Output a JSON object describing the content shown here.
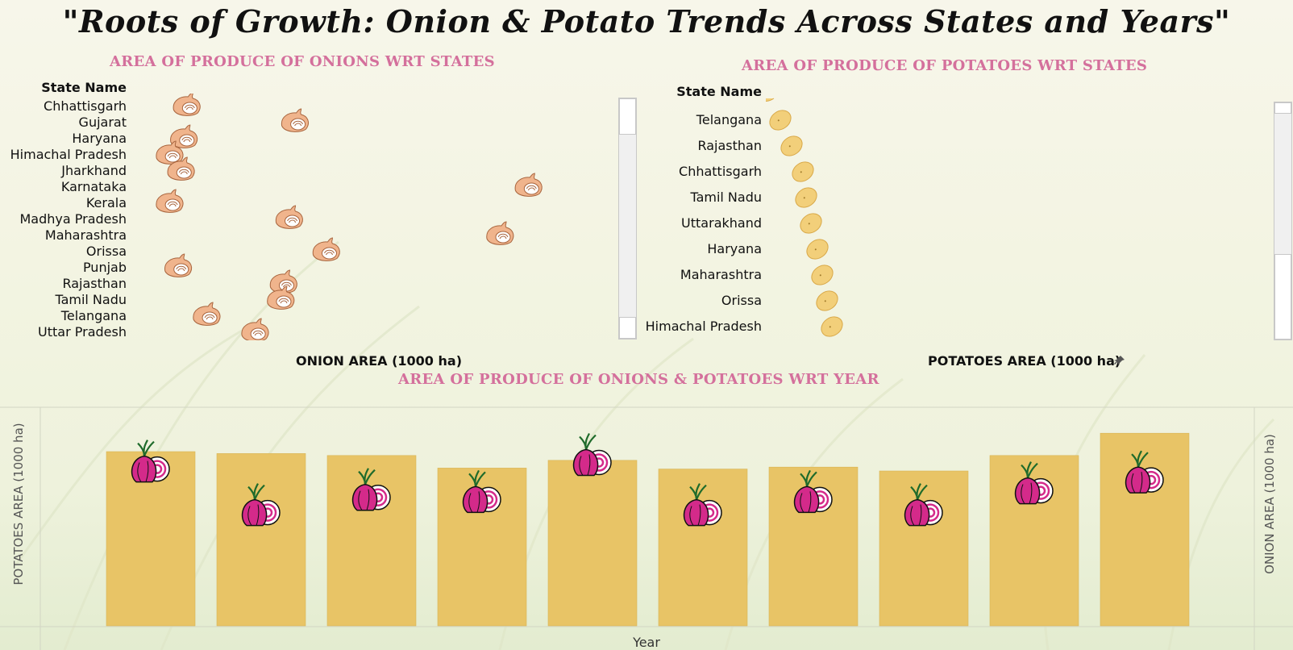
{
  "title": "\"Roots of Growth: Onion & Potato Trends Across States and Years\"",
  "onion_panel": {
    "title": "AREA OF PRODUCE OF ONIONS WRT STATES",
    "row_header": "State Name",
    "axis_title": "ONION AREA (1000 ha)"
  },
  "potato_panel": {
    "title": "AREA OF PRODUCE OF POTATOES WRT STATES",
    "row_header": "State Name",
    "axis_title": "POTATOES AREA (1000 ha)"
  },
  "year_panel": {
    "title": "AREA OF PRODUCE OF ONIONS & POTATOES WRT YEAR",
    "xlabel": "Year",
    "ylabel_left": "POTATOES AREA (1000 ha)",
    "ylabel_right": "ONION AREA (1000 ha)"
  },
  "colors": {
    "title_pink": "#d4709c",
    "bar_fill": "#e8c466",
    "onion_skin": "#f0b48c",
    "potato": "#f2cf7a",
    "red_onion": "#d42a8a"
  },
  "icons": [
    "onion-icon",
    "potato-icon",
    "red-onion-icon",
    "pin-icon"
  ],
  "chart_data": [
    {
      "type": "scatter",
      "mark": "onion-icon",
      "categories": [
        "Chhattisgarh",
        "Gujarat",
        "Haryana",
        "Himachal Pradesh",
        "Jharkhand",
        "Karnataka",
        "Kerala",
        "Madhya Pradesh",
        "Maharashtra",
        "Orissa",
        "Punjab",
        "Rajasthan",
        "Tamil Nadu",
        "Telangana",
        "Uttar Pradesh"
      ],
      "values": [
        10,
        48,
        9,
        4,
        8,
        130,
        4,
        46,
        120,
        59,
        7,
        44,
        43,
        17,
        34
      ],
      "xlabel": "ONION AREA (1000 ha)",
      "ylabel": "State Name"
    },
    {
      "type": "scatter",
      "mark": "potato-icon",
      "categories": [
        "Telangana",
        "Rajasthan",
        "Chhattisgarh",
        "Tamil Nadu",
        "Uttarakhand",
        "Haryana",
        "Maharashtra",
        "Orissa",
        "Himachal Pradesh"
      ],
      "values": [
        5,
        12,
        19,
        21,
        24,
        28,
        31,
        34,
        37
      ],
      "xlabel": "POTATOES AREA (1000 ha)",
      "ylabel": "State Name"
    },
    {
      "type": "bar",
      "categories": [
        "",
        "",
        "",
        "",
        "",
        "",
        "",
        "",
        "",
        ""
      ],
      "series": [
        {
          "values": [
            1800,
            1780,
            1760,
            1630,
            1710,
            1620,
            1640,
            1600,
            1760,
            1990
          ]
        },
        {
          "values": [
            1220,
            1020,
            1090,
            1080,
            1250,
            1020,
            1080,
            1020,
            1120,
            1170
          ]
        }
      ],
      "xlabel": "Year",
      "ylabel": "POTATOES AREA (1000 ha)",
      "y2label": "ONION AREA (1000 ha)"
    }
  ]
}
